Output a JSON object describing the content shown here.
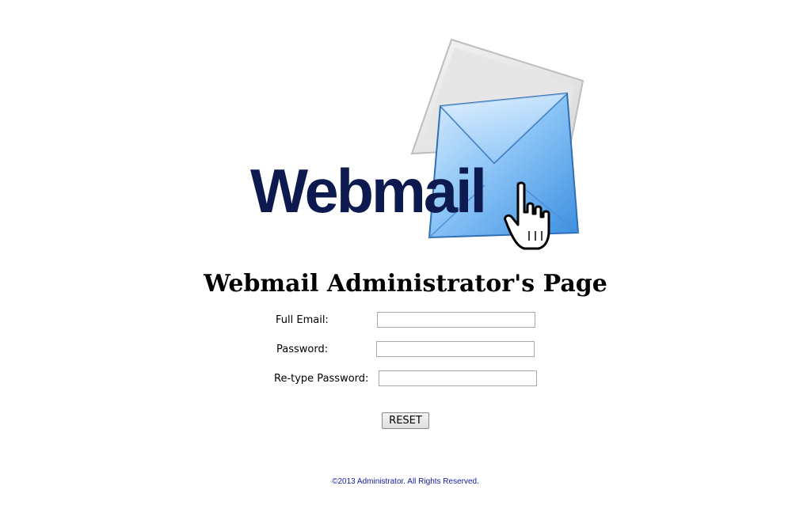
{
  "logo": {
    "text": "Webmail",
    "icon": "envelope-with-hand-cursor"
  },
  "page_title": "Webmail Administrator's Page",
  "form": {
    "full_email_label": "Full Email:",
    "full_email_value": "",
    "password_label": "Password:",
    "password_value": "",
    "retype_password_label": "Re-type Password:",
    "retype_password_value": ""
  },
  "reset_button_label": "RESET",
  "footer": {
    "copyright": "©2013 Administrator. All Rights Reserved."
  },
  "colors": {
    "logo_text": "#0c1a4f",
    "envelope": "#5aaaf0",
    "footer_text": "#1a1aa6"
  }
}
